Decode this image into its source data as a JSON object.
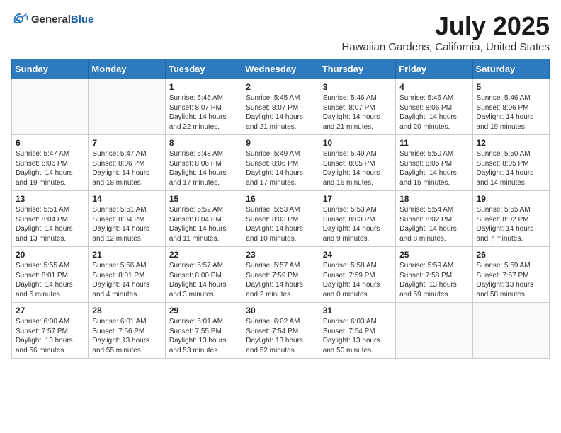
{
  "header": {
    "logo_general": "General",
    "logo_blue": "Blue",
    "month_year": "July 2025",
    "location": "Hawaiian Gardens, California, United States"
  },
  "weekdays": [
    "Sunday",
    "Monday",
    "Tuesday",
    "Wednesday",
    "Thursday",
    "Friday",
    "Saturday"
  ],
  "weeks": [
    [
      {
        "day": "",
        "info": ""
      },
      {
        "day": "",
        "info": ""
      },
      {
        "day": "1",
        "info": "Sunrise: 5:45 AM\nSunset: 8:07 PM\nDaylight: 14 hours and 22 minutes."
      },
      {
        "day": "2",
        "info": "Sunrise: 5:45 AM\nSunset: 8:07 PM\nDaylight: 14 hours and 21 minutes."
      },
      {
        "day": "3",
        "info": "Sunrise: 5:46 AM\nSunset: 8:07 PM\nDaylight: 14 hours and 21 minutes."
      },
      {
        "day": "4",
        "info": "Sunrise: 5:46 AM\nSunset: 8:06 PM\nDaylight: 14 hours and 20 minutes."
      },
      {
        "day": "5",
        "info": "Sunrise: 5:46 AM\nSunset: 8:06 PM\nDaylight: 14 hours and 19 minutes."
      }
    ],
    [
      {
        "day": "6",
        "info": "Sunrise: 5:47 AM\nSunset: 8:06 PM\nDaylight: 14 hours and 19 minutes."
      },
      {
        "day": "7",
        "info": "Sunrise: 5:47 AM\nSunset: 8:06 PM\nDaylight: 14 hours and 18 minutes."
      },
      {
        "day": "8",
        "info": "Sunrise: 5:48 AM\nSunset: 8:06 PM\nDaylight: 14 hours and 17 minutes."
      },
      {
        "day": "9",
        "info": "Sunrise: 5:49 AM\nSunset: 8:06 PM\nDaylight: 14 hours and 17 minutes."
      },
      {
        "day": "10",
        "info": "Sunrise: 5:49 AM\nSunset: 8:05 PM\nDaylight: 14 hours and 16 minutes."
      },
      {
        "day": "11",
        "info": "Sunrise: 5:50 AM\nSunset: 8:05 PM\nDaylight: 14 hours and 15 minutes."
      },
      {
        "day": "12",
        "info": "Sunrise: 5:50 AM\nSunset: 8:05 PM\nDaylight: 14 hours and 14 minutes."
      }
    ],
    [
      {
        "day": "13",
        "info": "Sunrise: 5:51 AM\nSunset: 8:04 PM\nDaylight: 14 hours and 13 minutes."
      },
      {
        "day": "14",
        "info": "Sunrise: 5:51 AM\nSunset: 8:04 PM\nDaylight: 14 hours and 12 minutes."
      },
      {
        "day": "15",
        "info": "Sunrise: 5:52 AM\nSunset: 8:04 PM\nDaylight: 14 hours and 11 minutes."
      },
      {
        "day": "16",
        "info": "Sunrise: 5:53 AM\nSunset: 8:03 PM\nDaylight: 14 hours and 10 minutes."
      },
      {
        "day": "17",
        "info": "Sunrise: 5:53 AM\nSunset: 8:03 PM\nDaylight: 14 hours and 9 minutes."
      },
      {
        "day": "18",
        "info": "Sunrise: 5:54 AM\nSunset: 8:02 PM\nDaylight: 14 hours and 8 minutes."
      },
      {
        "day": "19",
        "info": "Sunrise: 5:55 AM\nSunset: 8:02 PM\nDaylight: 14 hours and 7 minutes."
      }
    ],
    [
      {
        "day": "20",
        "info": "Sunrise: 5:55 AM\nSunset: 8:01 PM\nDaylight: 14 hours and 5 minutes."
      },
      {
        "day": "21",
        "info": "Sunrise: 5:56 AM\nSunset: 8:01 PM\nDaylight: 14 hours and 4 minutes."
      },
      {
        "day": "22",
        "info": "Sunrise: 5:57 AM\nSunset: 8:00 PM\nDaylight: 14 hours and 3 minutes."
      },
      {
        "day": "23",
        "info": "Sunrise: 5:57 AM\nSunset: 7:59 PM\nDaylight: 14 hours and 2 minutes."
      },
      {
        "day": "24",
        "info": "Sunrise: 5:58 AM\nSunset: 7:59 PM\nDaylight: 14 hours and 0 minutes."
      },
      {
        "day": "25",
        "info": "Sunrise: 5:59 AM\nSunset: 7:58 PM\nDaylight: 13 hours and 59 minutes."
      },
      {
        "day": "26",
        "info": "Sunrise: 5:59 AM\nSunset: 7:57 PM\nDaylight: 13 hours and 58 minutes."
      }
    ],
    [
      {
        "day": "27",
        "info": "Sunrise: 6:00 AM\nSunset: 7:57 PM\nDaylight: 13 hours and 56 minutes."
      },
      {
        "day": "28",
        "info": "Sunrise: 6:01 AM\nSunset: 7:56 PM\nDaylight: 13 hours and 55 minutes."
      },
      {
        "day": "29",
        "info": "Sunrise: 6:01 AM\nSunset: 7:55 PM\nDaylight: 13 hours and 53 minutes."
      },
      {
        "day": "30",
        "info": "Sunrise: 6:02 AM\nSunset: 7:54 PM\nDaylight: 13 hours and 52 minutes."
      },
      {
        "day": "31",
        "info": "Sunrise: 6:03 AM\nSunset: 7:54 PM\nDaylight: 13 hours and 50 minutes."
      },
      {
        "day": "",
        "info": ""
      },
      {
        "day": "",
        "info": ""
      }
    ]
  ]
}
